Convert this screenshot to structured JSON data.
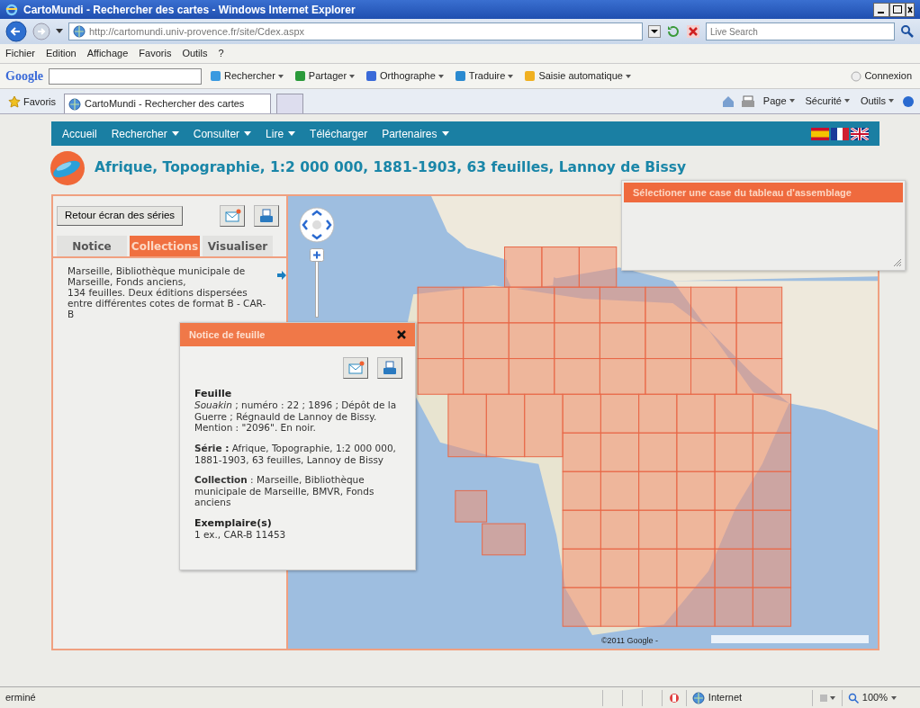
{
  "window": {
    "title": "CartoMundi - Rechercher des cartes - Windows Internet Explorer"
  },
  "address_bar": {
    "url": "http://cartomundi.univ-provence.fr/site/Cdex.aspx",
    "search_placeholder": "Live Search"
  },
  "menu": [
    "Fichier",
    "Edition",
    "Affichage",
    "Favoris",
    "Outils",
    "?"
  ],
  "google_toolbar": {
    "logo": "Google",
    "buttons": [
      {
        "kind": "search",
        "label": "Rechercher"
      },
      {
        "kind": "share",
        "label": "Partager"
      },
      {
        "kind": "spell",
        "label": "Orthographe"
      },
      {
        "kind": "translate",
        "label": "Traduire"
      },
      {
        "kind": "autofill",
        "label": "Saisie automatique"
      }
    ],
    "signin": "Connexion"
  },
  "favorites_bar": {
    "favorites": "Favoris",
    "tab": "CartoMundi - Rechercher des cartes",
    "commands": [
      "Page",
      "Sécurité",
      "Outils"
    ]
  },
  "site_nav": [
    {
      "label": "Accueil",
      "dropdown": false
    },
    {
      "label": "Rechercher",
      "dropdown": true
    },
    {
      "label": "Consulter",
      "dropdown": true
    },
    {
      "label": "Lire",
      "dropdown": true
    },
    {
      "label": "Télécharger",
      "dropdown": false
    },
    {
      "label": "Partenaires",
      "dropdown": true
    }
  ],
  "languages": [
    {
      "kind": "es"
    },
    {
      "kind": "fr"
    },
    {
      "kind": "uk"
    }
  ],
  "page_title": "Afrique, Topographie, 1:2 000 000, 1881-1903, 63 feuilles, Lannoy de Bissy",
  "left_panel": {
    "back_button": "Retour écran des séries",
    "tabs": [
      {
        "label": "Notice",
        "selected": false
      },
      {
        "label": "Collections",
        "selected": true
      },
      {
        "label": "Visualiser",
        "selected": false
      }
    ],
    "collection_text": "Marseille, Bibliothèque municipale de Marseille, Fonds anciens,\n134 feuilles. Deux éditions dispersées entre différentes cotes de format B - CAR-B"
  },
  "sheet_popup": {
    "title": "Notice de feuille",
    "sections": [
      {
        "kind": "block",
        "heading": "Feuille",
        "text": "*Souakin* ; numéro : 22 ; 1896 ; Dépôt de la Guerre ; Régnauld de Lannoy de Bissy. Mention : \"2096\". En noir."
      },
      {
        "kind": "inline",
        "text": "**Série :** Afrique, Topographie, 1:2 000 000, 1881-1903, 63 feuilles, Lannoy de Bissy"
      },
      {
        "kind": "inline",
        "text": "**Collection** : Marseille, Bibliothèque municipale de Marseille, BMVR, Fonds anciens"
      },
      {
        "kind": "block",
        "heading": "Exemplaire(s)",
        "text": "1 ex., CAR-B 11453"
      }
    ]
  },
  "grid_panel": {
    "title": "Sélectioner une case du tableau d'assemblage"
  },
  "map": {
    "kind": "picture",
    "attribution": "©2011 Google -"
  },
  "status_bar": {
    "text": "erminé",
    "zone": "Internet",
    "zoom": "100%"
  }
}
